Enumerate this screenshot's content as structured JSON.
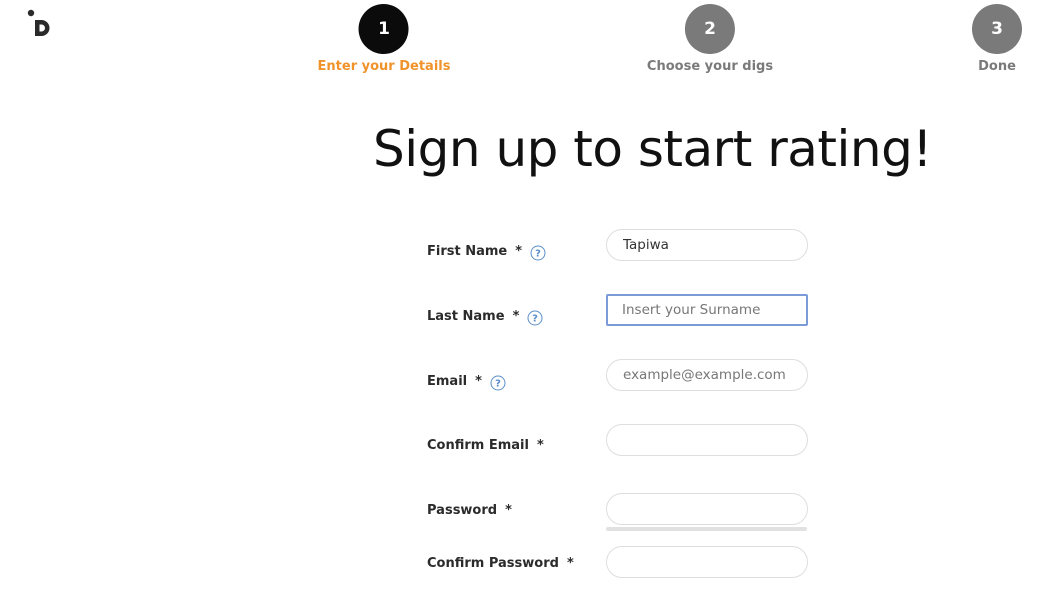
{
  "header": {
    "logo_name": "digs-logo",
    "steps": [
      {
        "number": "1",
        "label": "Enter your Details",
        "state": "active",
        "circle_color": "#0b0b0b",
        "label_color": "#f0932b"
      },
      {
        "number": "2",
        "label": "Choose your digs",
        "state": "inactive",
        "circle_color": "#7a7a7a",
        "label_color": "#7a7a7a"
      },
      {
        "number": "3",
        "label": "Done",
        "state": "inactive",
        "circle_color": "#7a7a7a",
        "label_color": "#7a7a7a"
      }
    ]
  },
  "main": {
    "title": "Sign up to start rating!"
  },
  "form": {
    "required_mark": "*",
    "first_name": {
      "label": "First Name",
      "value": "Tapiwa",
      "placeholder": "",
      "help_icon": "help-question-icon"
    },
    "last_name": {
      "label": "Last Name",
      "value": "",
      "placeholder": "Insert your Surname",
      "focused": true,
      "help_icon": "help-question-icon"
    },
    "email": {
      "label": "Email",
      "value": "",
      "placeholder": "example@example.com",
      "help_icon": "help-question-icon"
    },
    "confirm_email": {
      "label": "Confirm Email",
      "value": "",
      "placeholder": ""
    },
    "password": {
      "label": "Password",
      "value": "",
      "placeholder": ""
    },
    "confirm_password": {
      "label": "Confirm Password",
      "value": "",
      "placeholder": ""
    }
  },
  "colors": {
    "accent_orange": "#f0932b",
    "active_step": "#0b0b0b",
    "inactive_step": "#7a7a7a",
    "focus_border": "#7b9bd8",
    "help_icon_blue": "#5b8fc9"
  }
}
